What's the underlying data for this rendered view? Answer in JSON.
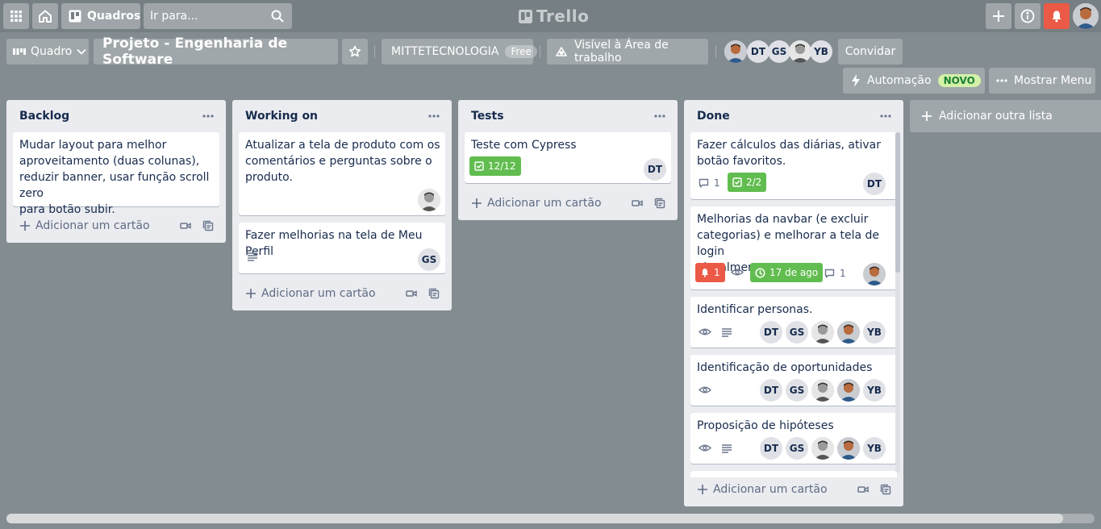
{
  "header": {
    "boards_label": "Quadros",
    "search_placeholder": "Ir para...",
    "logo_text": "Trello"
  },
  "board": {
    "view_label": "Quadro",
    "title": "Projeto - Engenharia de Software",
    "workspace_name": "MITTETECNOLOGIA",
    "workspace_plan": "Free",
    "visibility_label": "Visível à Área de trabalho",
    "members": [
      "DT",
      "GS",
      "YB"
    ],
    "invite_label": "Convidar",
    "automation_label": "Automação",
    "automation_badge": "NOVO",
    "menu_label": "Mostrar Menu"
  },
  "lists": [
    {
      "name": "Backlog",
      "cards": [
        {
          "text": "Mudar layout para melhor\naproveitamento (duas colunas),\nreduzir banner, usar função scroll zero\npara botão subir."
        }
      ],
      "add_label": "Adicionar um cartão"
    },
    {
      "name": "Working on",
      "cards": [
        {
          "text": "Atualizar a tela de produto com os\ncomentários e perguntas sobre o\nproduto."
        },
        {
          "text": "Fazer melhorias na tela de Meu Perfil",
          "member": "GS"
        }
      ],
      "add_label": "Adicionar um cartão"
    },
    {
      "name": "Tests",
      "cards": [
        {
          "text": "Teste com Cypress",
          "checklist": "12/12",
          "member": "DT"
        }
      ],
      "add_label": "Adicionar um cartão"
    },
    {
      "name": "Done",
      "cards": [
        {
          "text": "Fazer cálculos das diárias, ativar\nbotão favoritos.",
          "comments": "1",
          "checklist": "2/2",
          "member": "DT"
        },
        {
          "text": "Melhorias da navbar (e excluir\ncategorias) e melhorar a tela de login\nvisualmente",
          "notifications": "1",
          "due": "17 de ago",
          "comments": "1"
        },
        {
          "text": "Identificar personas.",
          "members": [
            "DT",
            "GS",
            "YB"
          ]
        },
        {
          "text": "Identificação de oportunidades",
          "members": [
            "DT",
            "GS",
            "YB"
          ]
        },
        {
          "text": "Proposição de hipóteses",
          "members": [
            "DT",
            "GS",
            "YB"
          ]
        }
      ],
      "add_label": "Adicionar um cartão"
    }
  ],
  "add_list_label": "Adicionar outra lista",
  "colors": {
    "background": "#838c91",
    "green_badge": "#61bd4f",
    "red_badge": "#eb5a46",
    "notification_button": "#eb5a46"
  }
}
